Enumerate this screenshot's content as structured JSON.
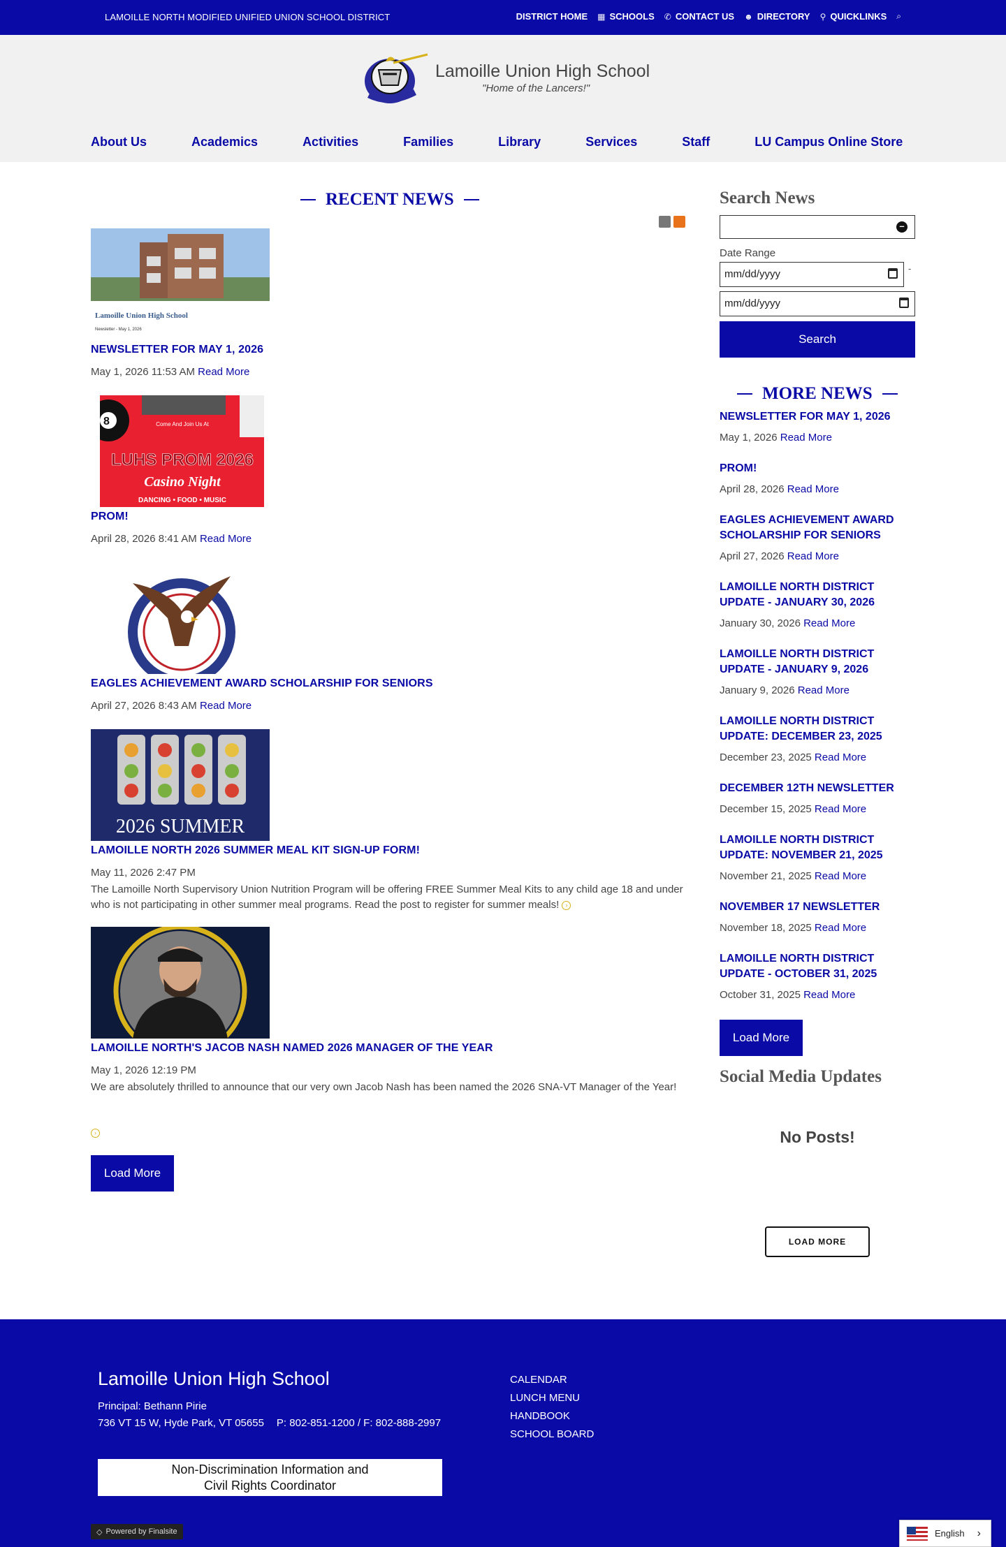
{
  "utility": {
    "district": "LAMOILLE NORTH MODIFIED UNIFIED UNION SCHOOL DISTRICT",
    "links": [
      "DISTRICT HOME",
      "SCHOOLS",
      "CONTACT US",
      "DIRECTORY",
      "QUICKLINKS"
    ]
  },
  "header": {
    "school_name": "Lamoille Union High School",
    "tagline": "\"Home of the Lancers!\""
  },
  "nav": [
    "About Us",
    "Academics",
    "Activities",
    "Families",
    "Library",
    "Services",
    "Staff",
    "LU Campus Online Store"
  ],
  "main": {
    "section_title": "RECENT NEWS",
    "news": [
      {
        "title": "NEWSLETTER FOR MAY 1, 2026",
        "date": "May 1, 2026 11:53 AM",
        "read_more": "Read More",
        "thumb_caption": "Lamoille Union High School",
        "thumb_sub": "Newsletter - May 1, 2026"
      },
      {
        "title": "PROM!",
        "date": "April 28, 2026 8:41 AM",
        "read_more": "Read More",
        "thumb_top": "Come And Join Us At",
        "thumb_main": "LUHS PROM 2026",
        "thumb_script": "Casino Night",
        "thumb_sub": "DANCING • FOOD • MUSIC"
      },
      {
        "title": "EAGLES ACHIEVEMENT AWARD SCHOLARSHIP FOR SENIORS",
        "date": "April 27, 2026 8:43 AM",
        "read_more": "Read More"
      },
      {
        "title": "LAMOILLE NORTH 2026 SUMMER MEAL KIT SIGN-UP FORM!",
        "date": "May 11, 2026 2:47 PM",
        "body": "The Lamoille North Supervisory Union Nutrition Program will be offering FREE Summer Meal Kits to any child age 18 and under who is not participating in other summer meal programs. Read the post to register for summer meals!",
        "thumb_text": "2026 SUMMER"
      },
      {
        "title": "LAMOILLE NORTH'S JACOB NASH NAMED 2026 MANAGER OF THE YEAR",
        "date": "May 1, 2026 12:19 PM",
        "body": "We are absolutely thrilled to announce that our very own Jacob Nash has been named the 2026 SNA-VT Manager of the Year!"
      }
    ],
    "load_more": "Load More"
  },
  "sidebar": {
    "search_title": "Search News",
    "date_range_label": "Date Range",
    "date_placeholder": "mm/dd/yyyy",
    "date_separator": "-",
    "search_button": "Search",
    "more_news_title": "MORE NEWS",
    "more_news": [
      {
        "title": "NEWSLETTER FOR MAY 1, 2026",
        "date": "May 1, 2026",
        "read_more": "Read More"
      },
      {
        "title": "PROM!",
        "date": "April 28, 2026",
        "read_more": "Read More"
      },
      {
        "title": "EAGLES ACHIEVEMENT AWARD SCHOLARSHIP FOR SENIORS",
        "date": "April 27, 2026",
        "read_more": "Read More"
      },
      {
        "title": "LAMOILLE NORTH DISTRICT UPDATE - JANUARY 30, 2026",
        "date": "January 30, 2026",
        "read_more": "Read More"
      },
      {
        "title": "LAMOILLE NORTH DISTRICT UPDATE - JANUARY 9, 2026",
        "date": "January 9, 2026",
        "read_more": "Read More"
      },
      {
        "title": "LAMOILLE NORTH DISTRICT UPDATE: DECEMBER 23, 2025",
        "date": "December 23, 2025",
        "read_more": "Read More"
      },
      {
        "title": "DECEMBER 12TH NEWSLETTER",
        "date": "December 15, 2025",
        "read_more": "Read More"
      },
      {
        "title": "LAMOILLE NORTH DISTRICT UPDATE: NOVEMBER 21, 2025",
        "date": "November 21, 2025",
        "read_more": "Read More"
      },
      {
        "title": "NOVEMBER 17 NEWSLETTER",
        "date": "November 18, 2025",
        "read_more": "Read More"
      },
      {
        "title": "LAMOILLE NORTH DISTRICT UPDATE - OCTOBER 31, 2025",
        "date": "October 31, 2025",
        "read_more": "Read More"
      }
    ],
    "load_more": "Load More",
    "social_title": "Social Media Updates",
    "no_posts": "No Posts!",
    "social_load_more": "LOAD MORE"
  },
  "footer": {
    "school_name": "Lamoille Union High School",
    "principal": "Principal: Bethann Pirie",
    "address": "736 VT 15 W, Hyde Park, VT 05655",
    "phone": "P: 802-851-1200 / F: 802-888-2997",
    "links": [
      "CALENDAR",
      "LUNCH MENU",
      "HANDBOOK",
      "SCHOOL BOARD"
    ],
    "nondisc_line1": "Non-Discrimination Information and",
    "nondisc_line2": "Civil Rights Coordinator",
    "powered": "Powered by Finalsite"
  },
  "language": {
    "selected": "English"
  },
  "colors": {
    "brand": "#0a0aa6",
    "accent_gold": "#d8b21a"
  }
}
